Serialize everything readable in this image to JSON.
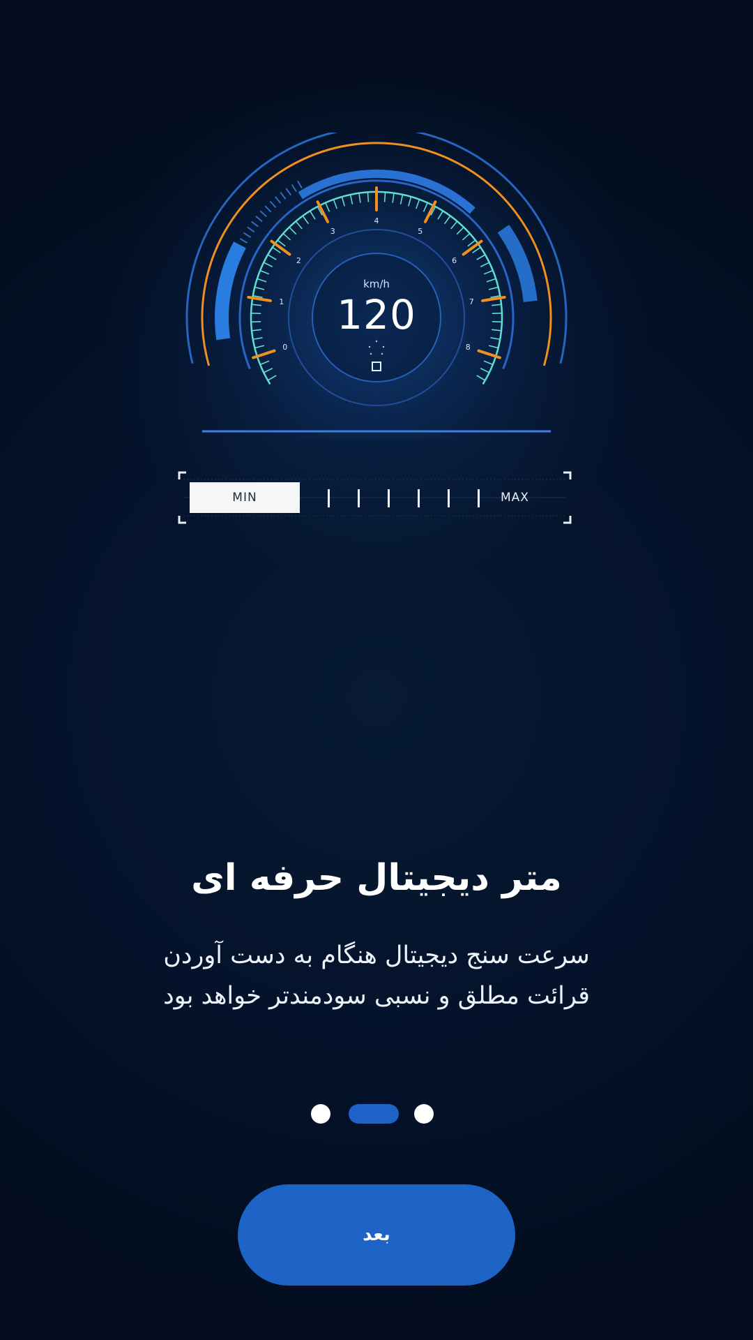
{
  "speedometer": {
    "unit": "km/h",
    "speed": "120",
    "scale_numbers": [
      "0",
      "1",
      "2",
      "3",
      "4",
      "5",
      "6",
      "7",
      "8"
    ],
    "colors": {
      "accent_orange": "#f0901e",
      "accent_blue": "#2a7de0",
      "tick_teal": "#5fe0d0"
    }
  },
  "range_bar": {
    "min_label": "MIN",
    "max_label": "MAX",
    "level": 0
  },
  "onboarding": {
    "title": "متر دیجیتال حرفه ای",
    "description_lines": [
      "سرعت سنج دیجیتال هنگام به دست آوردن",
      "قرائت مطلق و نسبی سودمندتر خواهد بود"
    ]
  },
  "pager": {
    "total": 3,
    "active_index": 1
  },
  "next_button": {
    "label": "بعد"
  },
  "colors": {
    "background": "#041326",
    "primary": "#1e63c6"
  }
}
